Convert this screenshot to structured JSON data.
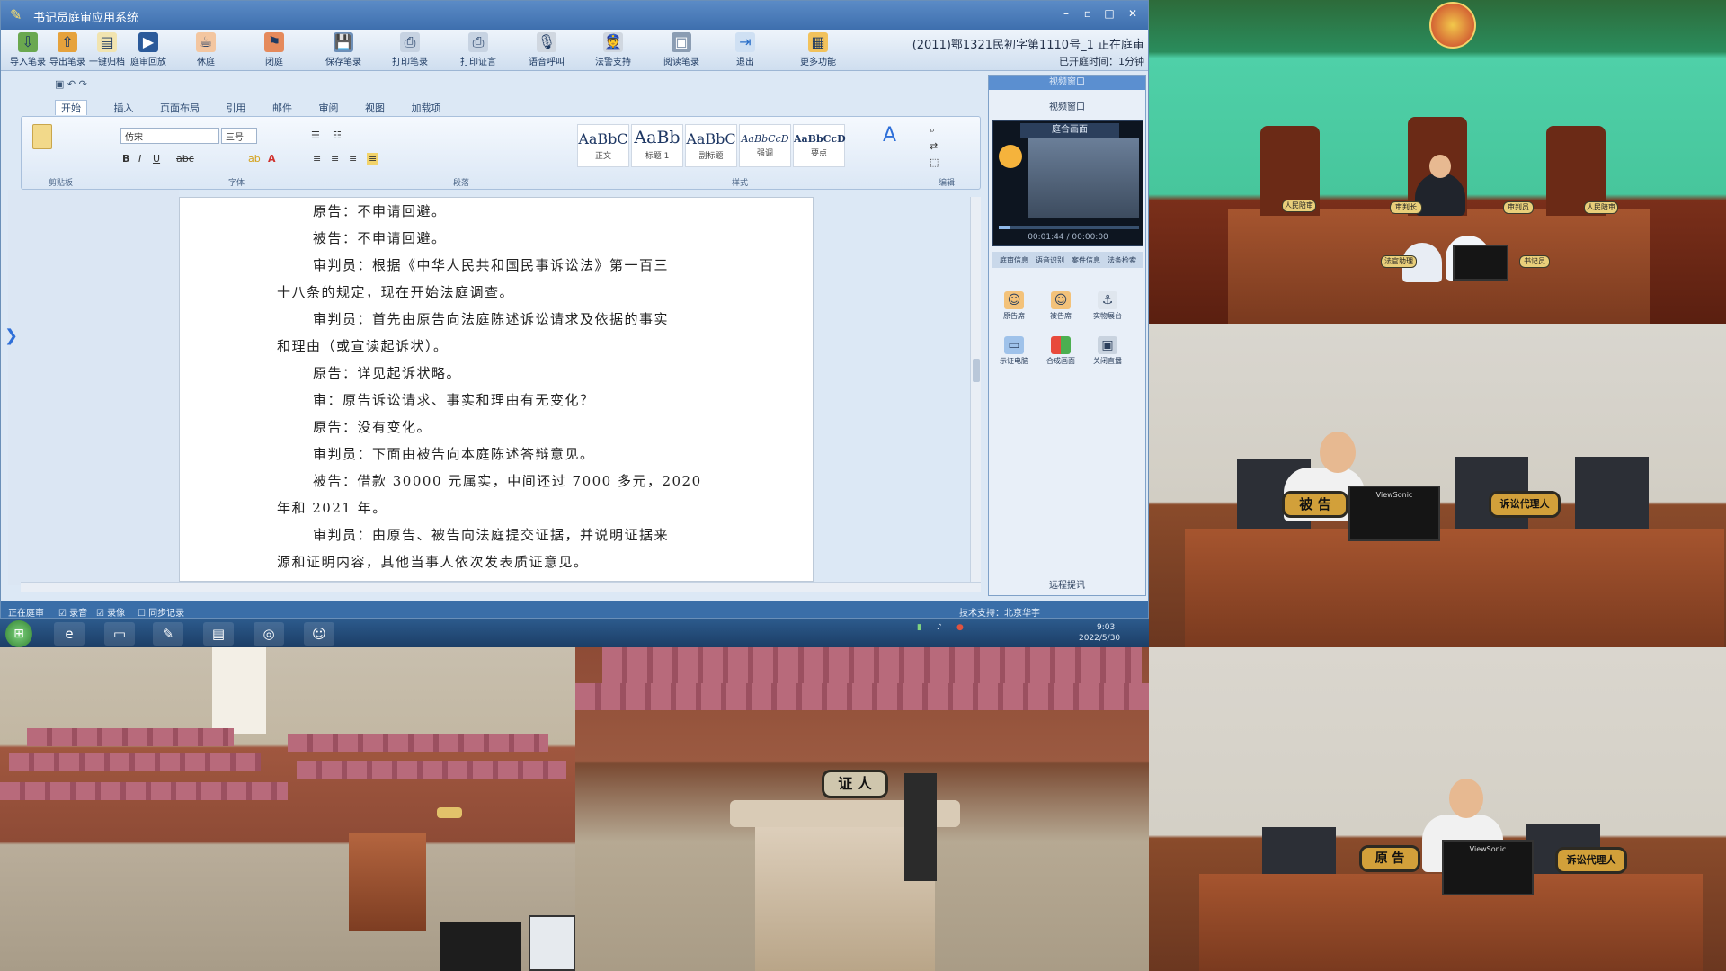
{
  "app": {
    "title": "书记员庭审应用系统",
    "toolbar": [
      {
        "label": "导入笔录",
        "icon": "import-icon"
      },
      {
        "label": "导出笔录",
        "icon": "export-icon"
      },
      {
        "label": "一键归档",
        "icon": "archive-icon"
      },
      {
        "label": "庭审回放",
        "icon": "replay-icon"
      },
      {
        "label": "休庭",
        "icon": "recess-icon"
      },
      {
        "label": "闭庭",
        "icon": "close-court-icon"
      },
      {
        "label": "保存笔录",
        "icon": "save-icon"
      },
      {
        "label": "打印笔录",
        "icon": "print-icon"
      },
      {
        "label": "打印证言",
        "icon": "print-testimony-icon"
      },
      {
        "label": "语音呼叫",
        "icon": "voice-call-icon"
      },
      {
        "label": "法警支持",
        "icon": "bailiff-icon"
      },
      {
        "label": "阅读笔录",
        "icon": "read-icon"
      },
      {
        "label": "退出",
        "icon": "exit-icon"
      },
      {
        "label": "更多功能",
        "icon": "more-icon"
      }
    ],
    "case_title": "(2011)鄂1321民初字第1110号_1 正在庭审",
    "case_elapsed": "已开庭时间：1分钟"
  },
  "editor": {
    "tabs": [
      "开始",
      "插入",
      "页面布局",
      "引用",
      "邮件",
      "审阅",
      "视图",
      "加载项"
    ],
    "active_tab": "开始",
    "font_name": "仿宋",
    "font_size": "三号",
    "styles": [
      {
        "preview": "AaBbC",
        "name": "正文"
      },
      {
        "preview": "AaBb",
        "name": "标题 1"
      },
      {
        "preview": "AaBbC",
        "name": "副标题"
      },
      {
        "preview": "AaBbCcD",
        "name": "强调"
      },
      {
        "preview": "AaBbCcD",
        "name": "要点"
      }
    ],
    "groups": [
      "剪贴板",
      "字体",
      "段落",
      "样式",
      "编辑"
    ],
    "document_lines": [
      {
        "indent": true,
        "text": "原告：不申请回避。"
      },
      {
        "indent": true,
        "text": "被告：不申请回避。"
      },
      {
        "indent": true,
        "text": "审判员：根据《中华人民共和国民事诉讼法》第一百三"
      },
      {
        "indent": false,
        "text": "十八条的规定，现在开始法庭调查。"
      },
      {
        "indent": true,
        "text": "审判员：首先由原告向法庭陈述诉讼请求及依据的事实"
      },
      {
        "indent": false,
        "text": "和理由（或宣读起诉状）。"
      },
      {
        "indent": true,
        "text": "原告：详见起诉状略。"
      },
      {
        "indent": true,
        "text": "审：原告诉讼请求、事实和理由有无变化？"
      },
      {
        "indent": true,
        "text": "原告：没有变化。"
      },
      {
        "indent": true,
        "text": "审判员：下面由被告向本庭陈述答辩意见。"
      },
      {
        "indent": true,
        "text": "被告：借款 30000 元属实，中间还过 7000 多元，2020"
      },
      {
        "indent": false,
        "text": "年和 2021 年。"
      },
      {
        "indent": true,
        "text": "审判员：由原告、被告向法庭提交证据，并说明证据来"
      },
      {
        "indent": false,
        "text": "源和证明内容，其他当事人依次发表质证意见。"
      }
    ]
  },
  "side_panel": {
    "header": "视频窗口",
    "video_window_label": "视频窗口",
    "video_source": "庭合画面",
    "video_time": "00:01:44 / 00:00:00",
    "video_progress": 0.08,
    "tabs": [
      "庭审信息",
      "语音识别",
      "案件信息",
      "法条检索"
    ],
    "buttons": [
      {
        "label": "原告席",
        "icon": "plaintiff-seat-icon"
      },
      {
        "label": "被告席",
        "icon": "defendant-seat-icon"
      },
      {
        "label": "实物展台",
        "icon": "document-camera-icon"
      },
      {
        "label": "示证电脑",
        "icon": "evidence-pc-icon"
      },
      {
        "label": "合成画面",
        "icon": "composite-icon"
      },
      {
        "label": "关闭直播",
        "icon": "stop-live-icon"
      }
    ],
    "footer": "远程提讯"
  },
  "statusbar": {
    "left": "正在庭审",
    "check1": "录音",
    "check2": "录像",
    "check3": "同步记录",
    "right": "技术支持：北京华宇"
  },
  "taskbar": {
    "time": "9:03",
    "date": "2022/5/30"
  },
  "cameras": {
    "judge_tags": [
      "人民陪审",
      "审判长",
      "审判员",
      "人民陪审"
    ],
    "clerk_tags": [
      "法官助理",
      "书记员"
    ],
    "defendant_plate": "被 告",
    "defendant_agent_plate": "诉讼代理人",
    "witness_plate": "证 人",
    "plaintiff_plate": "原 告",
    "plaintiff_agent_plate": "诉讼代理人",
    "monitor_brand": "ViewSonic"
  },
  "colors": {
    "title_bar": "#3e6fae",
    "accent": "#2e6fd8",
    "courtroom_wood": "#8a4b2b",
    "nameplate": "#d2a03a"
  }
}
